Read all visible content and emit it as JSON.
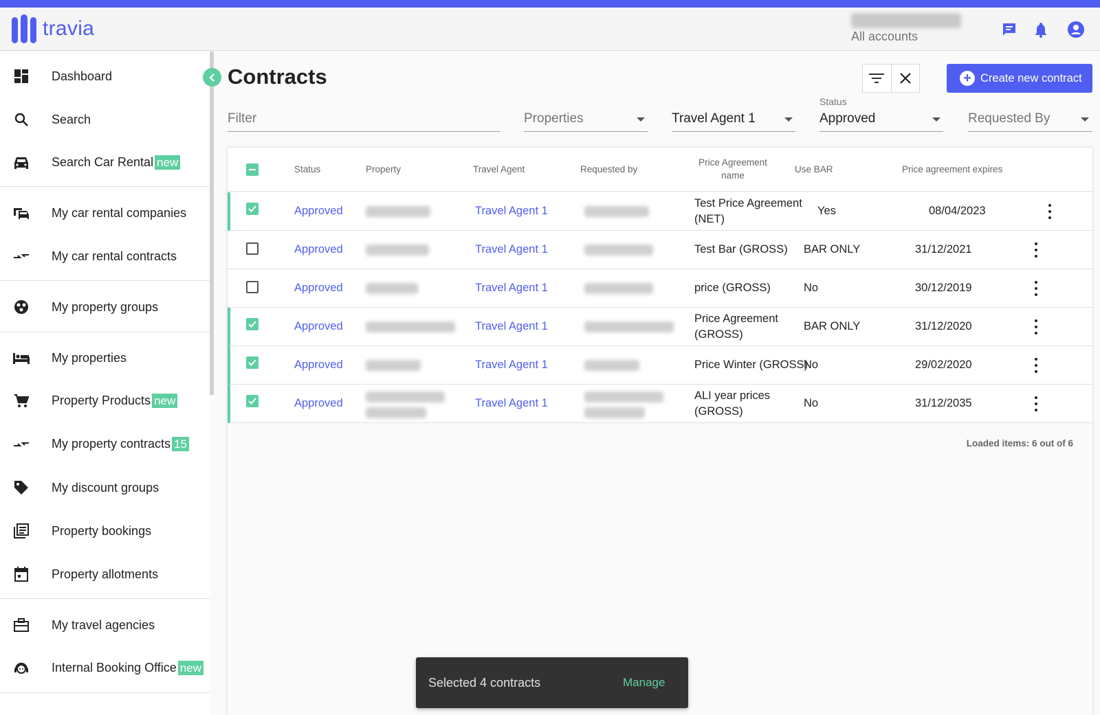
{
  "app": {
    "brand": "travia",
    "account_sub": "All accounts",
    "accent": "#4f5ef0",
    "green": "#5ecfa0"
  },
  "sidebar": {
    "items": [
      {
        "label": "Dashboard",
        "icon": "dashboard-icon"
      },
      {
        "label": "Search",
        "icon": "search-icon"
      },
      {
        "label": "Search Car Rental",
        "badge": "new",
        "icon": "car-icon"
      },
      {
        "label": "My car rental companies",
        "icon": "car-companies-icon"
      },
      {
        "label": "My car rental contracts",
        "icon": "contracts-arrows-icon"
      },
      {
        "label": "My property groups",
        "icon": "property-groups-icon"
      },
      {
        "label": "My properties",
        "icon": "bed-icon"
      },
      {
        "label": "Property Products",
        "badge": "new",
        "icon": "cart-icon"
      },
      {
        "label": "My property contracts",
        "badge": "15",
        "icon": "contracts-arrows-icon"
      },
      {
        "label": "My discount groups",
        "icon": "tag-icon"
      },
      {
        "label": "Property bookings",
        "icon": "bookings-icon"
      },
      {
        "label": "Property allotments",
        "icon": "calendar-icon"
      },
      {
        "label": "My travel agencies",
        "icon": "briefcase-icon"
      },
      {
        "label": "Internal Booking Office",
        "badge": "new",
        "icon": "support-agent-icon"
      }
    ]
  },
  "page": {
    "title": "Contracts",
    "create_label": "Create new contract"
  },
  "filters": {
    "filter_placeholder": "Filter",
    "properties": "Properties",
    "travel_agent": "Travel Agent 1",
    "status_label": "Status",
    "status": "Approved",
    "requested_by": "Requested By"
  },
  "table": {
    "headers": {
      "status": "Status",
      "property": "Property",
      "travel_agent": "Travel Agent",
      "requested_by": "Requested by",
      "price_agreement_1": "Price Agreement",
      "price_agreement_2": "name",
      "use_bar": "Use BAR",
      "expires": "Price agreement expires"
    },
    "rows": [
      {
        "checked": true,
        "status": "Approved",
        "agent": "Travel Agent 1",
        "pa1": "Test Price Agreement",
        "pa2": "(NET)",
        "bar": "Yes",
        "expires": "08/04/2023"
      },
      {
        "checked": false,
        "status": "Approved",
        "agent": "Travel Agent 1",
        "pa1": "Test Bar (GROSS)",
        "pa2": "",
        "bar": "BAR ONLY",
        "expires": "31/12/2021"
      },
      {
        "checked": false,
        "status": "Approved",
        "agent": "Travel Agent 1",
        "pa1": "price (GROSS)",
        "pa2": "",
        "bar": "No",
        "expires": "30/12/2019"
      },
      {
        "checked": true,
        "status": "Approved",
        "agent": "Travel Agent 1",
        "pa1": "Price Agreement",
        "pa2": "(GROSS)",
        "bar": "BAR ONLY",
        "expires": "31/12/2020"
      },
      {
        "checked": true,
        "status": "Approved",
        "agent": "Travel Agent 1",
        "pa1": "Price Winter (GROSS)",
        "pa2": "",
        "bar": "No",
        "expires": "29/02/2020"
      },
      {
        "checked": true,
        "status": "Approved",
        "agent": "Travel Agent 1",
        "pa1": "ALI year prices",
        "pa2": "(GROSS)",
        "bar": "No",
        "expires": "31/12/2035"
      }
    ],
    "loaded": "Loaded items: 6 out of 6"
  },
  "snackbar": {
    "message": "Selected 4 contracts",
    "action": "Manage"
  }
}
